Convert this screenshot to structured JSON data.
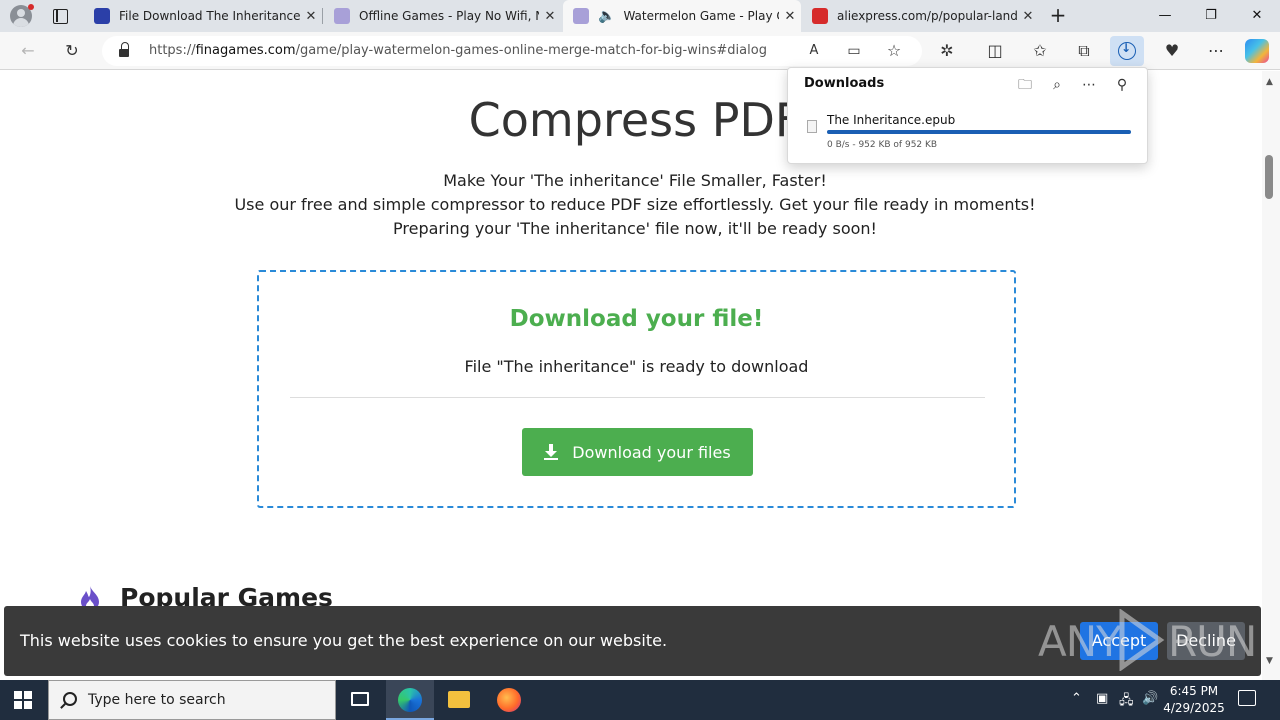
{
  "tabs": [
    {
      "title": "File Download The Inheritance PDF",
      "close": "✕",
      "favicon_color": "#2b3fa8"
    },
    {
      "title": "Offline Games - Play No Wifi, No",
      "close": "✕",
      "favicon_color": "#a8a0d8"
    },
    {
      "title": "Watermelon Game - Play Online",
      "close": "✕",
      "favicon_color": "#a8a0d8"
    },
    {
      "title": "aliexpress.com/p/popular-landing",
      "close": "✕",
      "favicon_color": "#d62b2b"
    }
  ],
  "address": {
    "host": "finagames.com",
    "prefix": "https://",
    "path": "/game/play-watermelon-games-online-merge-match-for-big-wins#dialog"
  },
  "page": {
    "title": "Compress PDF",
    "line1": "Make Your 'The inheritance' File Smaller, Faster!",
    "line2": "Use our free and simple compressor to reduce PDF size effortlessly. Get your file ready in moments!",
    "line3": "Preparing your 'The inheritance' file now, it'll be ready soon!",
    "box_title": "Download your file!",
    "box_ready": "File \"The inheritance\" is ready to download",
    "download_button": "Download your files",
    "popular_heading": "Popular Games"
  },
  "cookie": {
    "text": "This website uses cookies to ensure you get the best experience on our website.",
    "accept": "Accept",
    "decline": "Decline"
  },
  "downloads": {
    "title": "Downloads",
    "file_name": "The Inheritance.epub",
    "status": "0 B/s - 952 KB of 952 KB",
    "progress": 1.0
  },
  "watermark": {
    "left": "ANY",
    "right": "RUN"
  },
  "taskbar": {
    "search_placeholder": "Type here to search",
    "time": "6:45 PM",
    "date": "4/29/2025"
  },
  "colors": {
    "accent_green": "#4cae4f",
    "dashed_border": "#2a8ad8",
    "accept_blue": "#1f74e3"
  }
}
